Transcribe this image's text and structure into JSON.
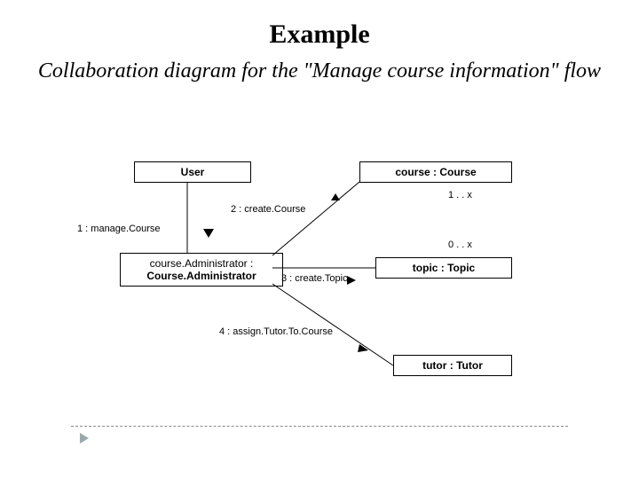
{
  "title": "Example",
  "subtitle": "Collaboration diagram for the \"Manage course information\" flow",
  "objects": {
    "user": "User",
    "course": "course : Course",
    "courseAdmin": {
      "line1": "course.Administrator :",
      "line2": "Course.Administrator"
    },
    "topic": "topic : Topic",
    "tutor": "tutor : Tutor"
  },
  "messages": {
    "m1": "1 : manage.Course",
    "m2": "2 : create.Course",
    "m3": "3 : create.Topic",
    "m4": "4 : assign.Tutor.To.Course"
  },
  "multiplicity": {
    "course": "1 . . x",
    "topic": "0 . . x"
  }
}
